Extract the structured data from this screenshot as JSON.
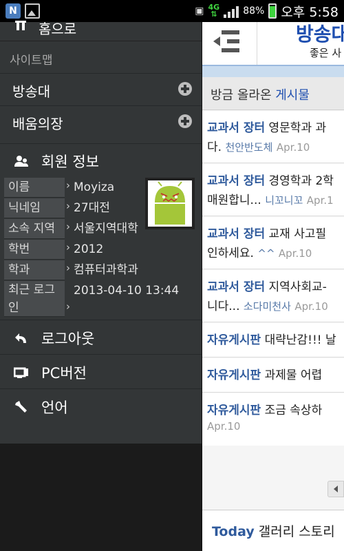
{
  "status_bar": {
    "notification_letter": "N",
    "network": "4G",
    "battery": "88%",
    "battery_level": 0.88,
    "time": "오후 5:58"
  },
  "drawer": {
    "home_label": "홈으로",
    "sitemap_label": "사이트맵",
    "menu": [
      {
        "label": "방송대"
      },
      {
        "label": "배움의장"
      }
    ],
    "member_title": "회원 정보",
    "member_info": [
      {
        "key": "이름",
        "value": "Moyiza"
      },
      {
        "key": "닉네임",
        "value": "27대전"
      },
      {
        "key": "소속 지역",
        "value": "서울지역대학"
      },
      {
        "key": "학번",
        "value": "2012"
      },
      {
        "key": "학과",
        "value": "컴퓨터과학과"
      },
      {
        "key": "최근 로그인",
        "value": "2013-04-10 13:44"
      }
    ],
    "actions": [
      {
        "label": "로그아웃",
        "icon": "undo-arrow-icon"
      },
      {
        "label": "PC버전",
        "icon": "monitor-icon"
      },
      {
        "label": "언어",
        "icon": "wrench-icon"
      }
    ]
  },
  "panel": {
    "title": "방송대",
    "subtitle": "좋은 사",
    "section_title_plain": "방금 올라온 ",
    "section_title_accent": "게시물",
    "posts": [
      {
        "category": "교과서 장터",
        "title": "영문학과 과",
        "line2": "다.",
        "author": "천안반도체",
        "date": "Apr.10"
      },
      {
        "category": "교과서 장터",
        "title": "경영학과 2학",
        "line2": "매원합니...",
        "author": "니꼬니꼬",
        "date": "Apr.1"
      },
      {
        "category": "교과서 장터",
        "title": "교재 사고필",
        "line2": "인하세요.",
        "author": "^^",
        "date": "Apr.10"
      },
      {
        "category": "교과서 장터",
        "title": "지역사회교-",
        "line2": "니다...",
        "author": "소다미천사",
        "date": "Apr.10"
      },
      {
        "category": "자유게시판",
        "title": "대략난감!!! 날",
        "line2": "",
        "author": "",
        "date": ""
      },
      {
        "category": "자유게시판",
        "title": "과제물 어렵",
        "line2": "",
        "author": "",
        "date": ""
      },
      {
        "category": "자유게시판",
        "title": "조금 속상하",
        "line2": "",
        "author": "",
        "date": "Apr.10"
      }
    ],
    "footer_accent": "Today",
    "footer_rest": " 갤러리 스토리"
  },
  "colors": {
    "accent_blue": "#1f4fb0",
    "drawer_bg": "#333637",
    "android_green": "#a4c639"
  }
}
